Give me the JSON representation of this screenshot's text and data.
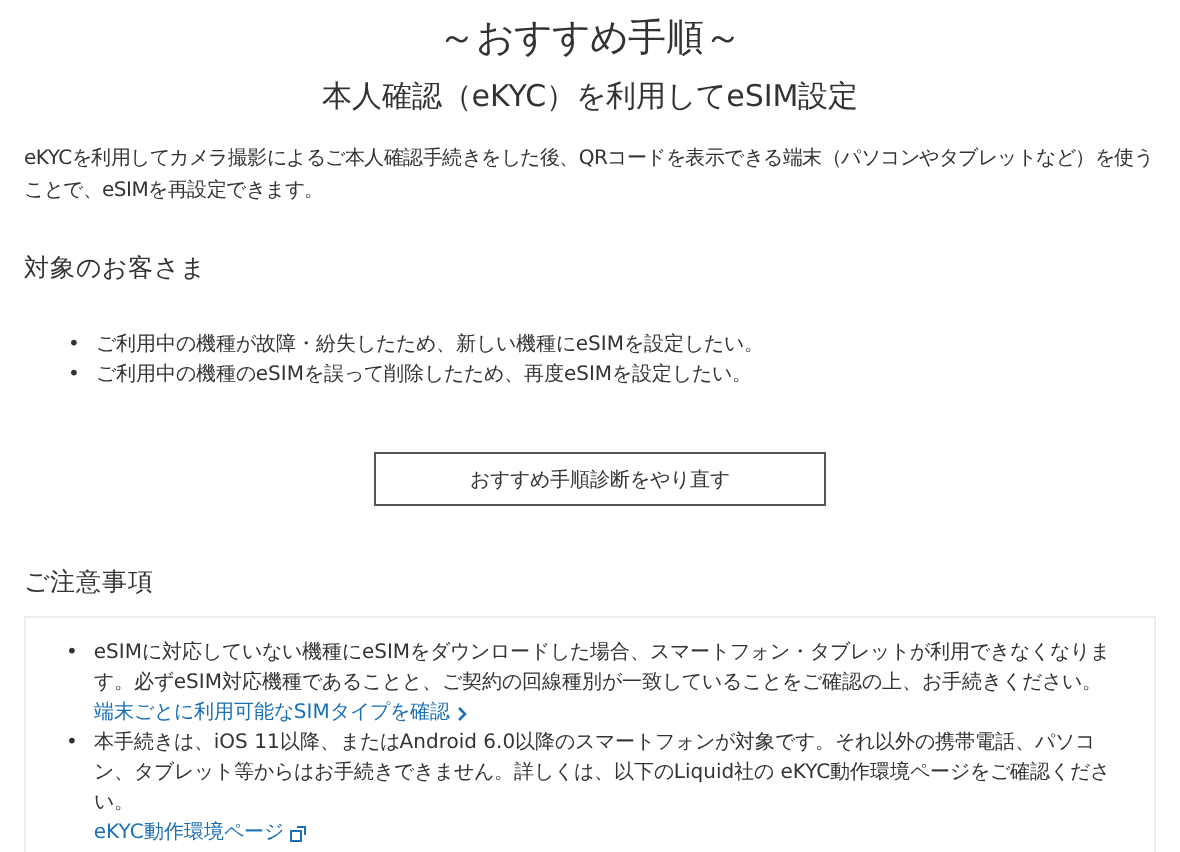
{
  "title": "～おすすめ手順～",
  "subtitle": "本人確認（eKYC）を利用してeSIM設定",
  "intro": "eKYCを利用してカメラ撮影によるご本人確認手続きをした後、QRコードを表示できる端末（パソコンやタブレットなど）を使うことで、eSIMを再設定できます。",
  "target": {
    "heading": "対象のお客さま",
    "items": [
      {
        "bullet": "•",
        "text": "ご利用中の機種が故障・紛失したため、新しい機種にeSIMを設定したい。"
      },
      {
        "bullet": "•",
        "text": "ご利用中の機種のeSIMを誤って削除したため、再度eSIMを設定したい。"
      }
    ]
  },
  "redo_button": "おすすめ手順診断をやり直す",
  "notes": {
    "heading": "ご注意事項",
    "items": [
      {
        "bullet": "•",
        "text": "eSIMに対応していない機種にeSIMをダウンロードした場合、スマートフォン・タブレットが利用できなくなります。必ずeSIM対応機種であることと、ご契約の回線種別が一致していることをご確認の上、お手続きください。",
        "link": "端末ごとに利用可能なSIMタイプを確認",
        "kind": "internal"
      },
      {
        "bullet": "•",
        "text": "本手続きは、iOS 11以降、またはAndroid 6.0以降のスマートフォンが対象です。それ以外の携帯電話、パソコン、タブレット等からはお手続きできません。詳しくは、以下のLiquid社の eKYC動作環境ページをご確認ください。",
        "link": "eKYC動作環境ページ",
        "kind": "external"
      }
    ]
  }
}
